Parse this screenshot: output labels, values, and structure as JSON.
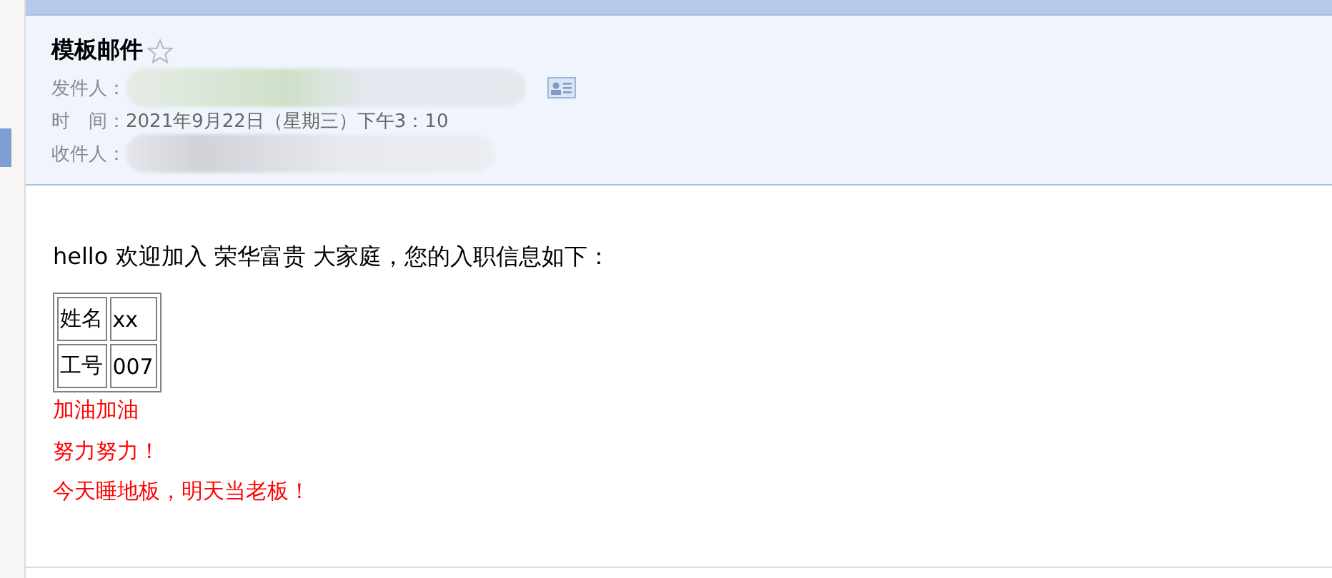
{
  "mail": {
    "subject": "模板邮件",
    "starred": false,
    "fields": [
      {
        "kind": "sender",
        "label": "发件人："
      },
      {
        "kind": "time",
        "label": "时　间：",
        "value": "2021年9月22日（星期三）下午3：10"
      },
      {
        "kind": "recipient",
        "label": "收件人："
      }
    ]
  },
  "body": {
    "greeting": "hello 欢迎加入 荣华富贵 大家庭，您的入职信息如下：",
    "table": [
      [
        "姓名",
        "xx"
      ],
      [
        "工号",
        "007"
      ]
    ],
    "lines": [
      "加油加油",
      "努力努力！",
      "今天睡地板，明天当老板！"
    ]
  }
}
